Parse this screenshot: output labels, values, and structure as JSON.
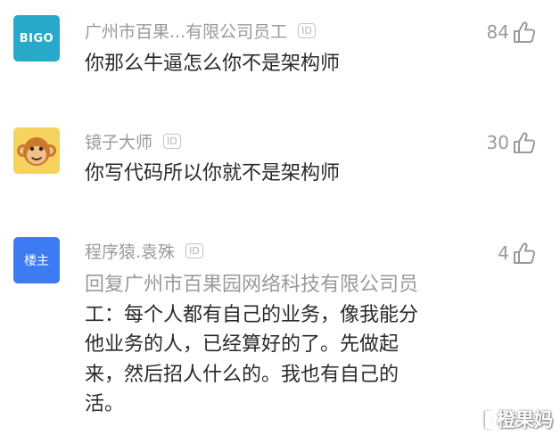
{
  "comments": [
    {
      "avatar_text": "BIGO",
      "avatar_icon": "bigo-logo-avatar",
      "username": "广州市百果...有限公司员工",
      "id_badge": "ID",
      "likes": "84",
      "lines": [
        "你那么牛逼怎么你不是架构师"
      ]
    },
    {
      "avatar_icon": "monkey-avatar",
      "username": "镜子大师",
      "id_badge": "ID",
      "likes": "30",
      "lines": [
        "你写代码所以你就不是架构师"
      ]
    },
    {
      "avatar_text": "楼主",
      "avatar_icon": "op-avatar",
      "username": "程序猿.袁殊",
      "id_badge": "ID",
      "likes": "4",
      "reply_prefix": "回复广州市百果园网络科技有限公司员",
      "lines": [
        "工：每个人都有自己的业务，像我能分",
        "他业务的人，已经算好的了。先做起",
        "来，然后招人什么的。我也有自己的",
        "活。"
      ]
    }
  ],
  "watermark": "橙果妈",
  "colors": {
    "username": "#9a9a9a",
    "body_text": "#2a2a2a",
    "reply_prefix": "#9a9a9a",
    "bigo_avatar": "#27a9c9",
    "op_avatar": "#3d7bf2",
    "monkey_avatar": "#f5d35e"
  }
}
